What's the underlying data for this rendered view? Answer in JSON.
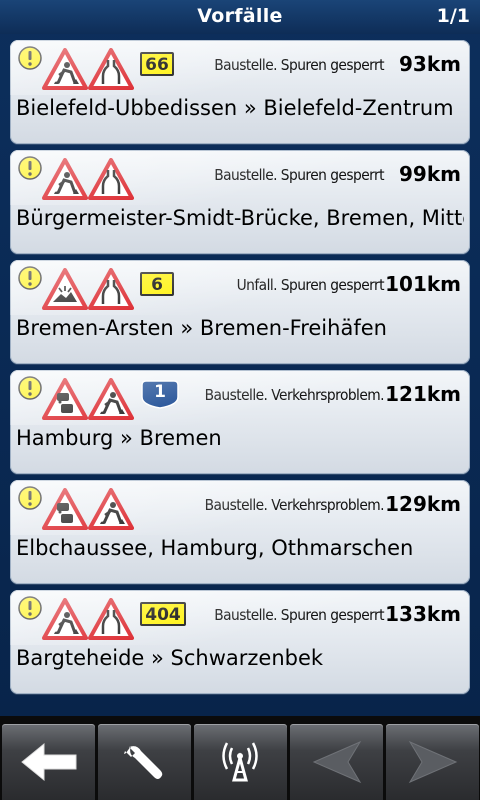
{
  "header": {
    "title": "Vorfälle",
    "page": "1/1"
  },
  "incidents": [
    {
      "road": "66",
      "road_style": "yellow",
      "sign1": "roadworks-sign-icon",
      "sign2": "road-narrows-sign-icon",
      "description": "Baustelle. Spuren gesperrt",
      "distance": "93km",
      "route": "Bielefeld-Ubbedissen » Bielefeld-Zentrum"
    },
    {
      "road": "",
      "road_style": "none",
      "sign1": "roadworks-sign-icon",
      "sign2": "road-narrows-sign-icon",
      "description": "Baustelle. Spuren gesperrt",
      "distance": "99km",
      "route": "Bürgermeister-Smidt-Brücke, Bremen, Mitte"
    },
    {
      "road": "6",
      "road_style": "yellow",
      "sign1": "accident-sign-icon",
      "sign2": "road-narrows-sign-icon",
      "description": "Unfall. Spuren gesperrt",
      "distance": "101km",
      "route": "Bremen-Arsten » Bremen-Freihäfen"
    },
    {
      "road": "1",
      "road_style": "shield",
      "sign1": "traffic-queue-sign-icon",
      "sign2": "roadworks-sign-icon",
      "description": "Baustelle. Verkehrsproblem.",
      "distance": "121km",
      "route": "Hamburg » Bremen"
    },
    {
      "road": "",
      "road_style": "none",
      "sign1": "traffic-queue-sign-icon",
      "sign2": "roadworks-sign-icon",
      "description": "Baustelle. Verkehrsproblem.",
      "distance": "129km",
      "route": "Elbchaussee, Hamburg, Othmarschen"
    },
    {
      "road": "404",
      "road_style": "yellow",
      "sign1": "roadworks-sign-icon",
      "sign2": "road-narrows-sign-icon",
      "description": "Baustelle. Spuren gesperrt",
      "distance": "133km",
      "route": "Bargteheide » Schwarzenbek"
    }
  ],
  "toolbar": {
    "buttons": [
      "back-arrow-icon",
      "wrench-icon",
      "antenna-icon",
      "prev-arrow-icon",
      "next-arrow-icon"
    ]
  },
  "colors": {
    "warning_yellow": "#fff200",
    "sign_red": "#d9141b",
    "shield_blue": "#0b3e8c"
  }
}
